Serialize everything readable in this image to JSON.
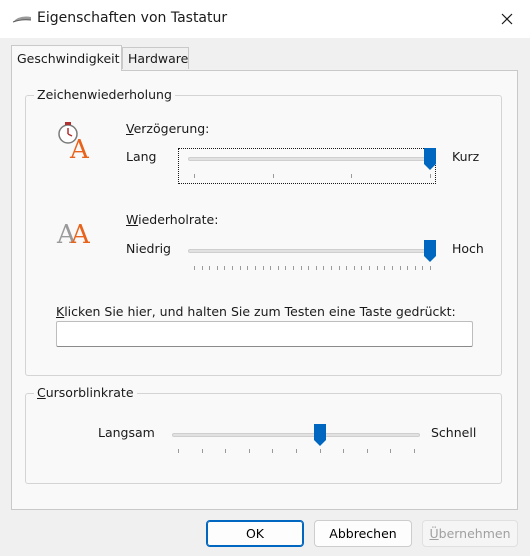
{
  "window": {
    "title": "Eigenschaften von Tastatur",
    "title_icon": "keyboard-icon",
    "close_icon": "close-icon"
  },
  "tabs": [
    {
      "label": "Geschwindigkeit",
      "active": true
    },
    {
      "label": "Hardware",
      "active": false
    }
  ],
  "repeat_group": {
    "label": "Zeichenwiederholung",
    "delay": {
      "icon": "clock-letter-a-icon",
      "label_prefix": "V",
      "label_rest": "erzögerung:",
      "min_label": "Lang",
      "max_label": "Kurz",
      "value": 3,
      "max": 3
    },
    "rate": {
      "icon": "double-letter-a-icon",
      "label_prefix": "W",
      "label_rest": "iederholrate:",
      "min_label": "Niedrig",
      "max_label": "Hoch",
      "value": 31,
      "max": 31
    },
    "test": {
      "label_prefix": "K",
      "label_rest": "licken Sie hier, und halten Sie zum Testen eine Taste gedrückt:",
      "value": ""
    }
  },
  "cursor_group": {
    "label_prefix": "C",
    "label_rest": "ursorblinkrate",
    "min_label": "Langsam",
    "max_label": "Schnell",
    "value": 6,
    "max": 10
  },
  "buttons": {
    "ok": "OK",
    "cancel": "Abbrechen",
    "apply_prefix": "Ü",
    "apply_rest": "bernehmen"
  },
  "colors": {
    "accent": "#0067c0",
    "icon_orange": "#e8631b"
  }
}
